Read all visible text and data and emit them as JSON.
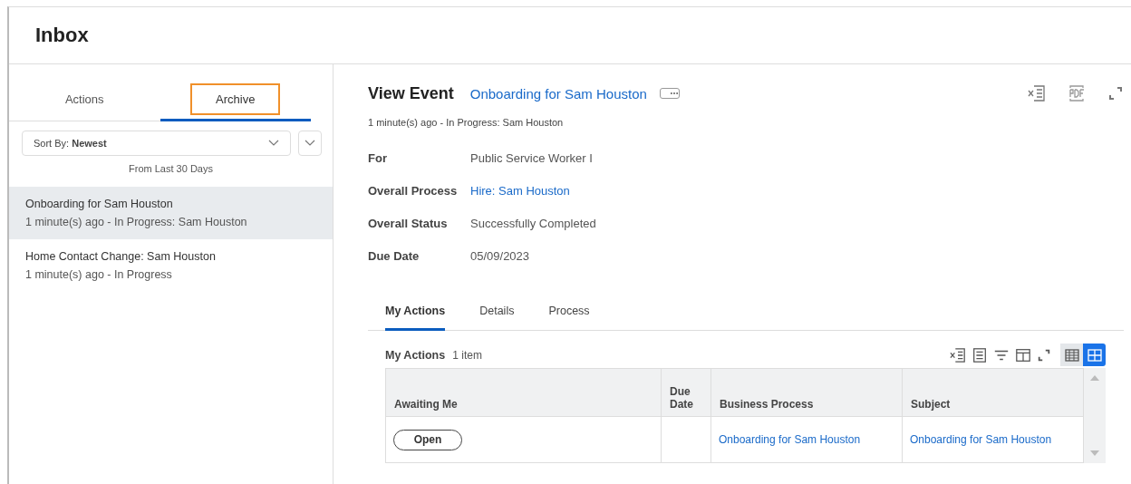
{
  "page_title": "Inbox",
  "inbox_tabs": [
    {
      "label": "Actions",
      "selected": false,
      "highlighted": false
    },
    {
      "label": "Archive",
      "selected": true,
      "highlighted": true
    }
  ],
  "sort": {
    "label": "Sort By:",
    "value": "Newest"
  },
  "range_note": "From Last 30 Days",
  "inbox_items": [
    {
      "title": "Onboarding for Sam Houston",
      "subtitle": "1 minute(s) ago - In Progress: Sam Houston",
      "selected": true
    },
    {
      "title": "Home Contact Change: Sam Houston",
      "subtitle": "1 minute(s) ago - In Progress",
      "selected": false
    }
  ],
  "event": {
    "heading": "View Event",
    "name": "Onboarding for Sam Houston",
    "status_line": "1 minute(s) ago - In Progress: Sam Houston",
    "fields": [
      {
        "label": "For",
        "value": "Public Service Worker I",
        "kind": "text"
      },
      {
        "label": "Overall Process",
        "value": "Hire: Sam Houston",
        "kind": "link"
      },
      {
        "label": "Overall Status",
        "value": "Successfully Completed",
        "kind": "text"
      },
      {
        "label": "Due Date",
        "value": "05/09/2023",
        "kind": "text"
      }
    ]
  },
  "detail_tabs": [
    {
      "label": "My Actions",
      "selected": true
    },
    {
      "label": "Details",
      "selected": false
    },
    {
      "label": "Process",
      "selected": false
    }
  ],
  "table": {
    "title": "My Actions",
    "count": "1 item",
    "view_modes": [
      {
        "selected": false
      },
      {
        "selected": true
      }
    ],
    "columns": [
      "Awaiting Me",
      "Due Date",
      "Business Process",
      "Subject"
    ],
    "rows": [
      {
        "action": "Open",
        "due_date": "",
        "business_process": "Onboarding for Sam Houston",
        "subject": "Onboarding for Sam Houston"
      }
    ]
  }
}
